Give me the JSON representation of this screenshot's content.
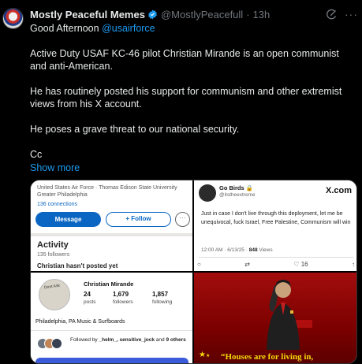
{
  "post": {
    "display_name": "Mostly Peaceful Memes",
    "handle": "@MostlyPeacefull",
    "time": "13h",
    "greeting": "Good Afternoon",
    "mention": "@usairforce",
    "paragraphs": [
      "Active Duty USAF KC-46 pilot Christian Mirande is an open communist and anti-American.",
      "He has routinely posted his support for communism and other extremist views from his X account.",
      "He poses a grave threat to our national security.",
      "Cc"
    ],
    "show_more": "Show more"
  },
  "panel_linkedin": {
    "subtitle": "United States Air Force · Thomas Edison State University",
    "location": "Greater Philadelphia",
    "connections": "136 connections",
    "message_label": "Message",
    "follow_label": "+ Follow",
    "more_label": "···",
    "activity_title": "Activity",
    "followers": "135 followers",
    "no_posts": "Christian hasn't posted yet"
  },
  "panel_xpost": {
    "name": "Go Birds",
    "handle": "@itstheextreme",
    "logo": "X.com",
    "text": "Just in case I don't live through this deployment, let me be unequivocal, fuck Israel, Free Palestine, Communism will win",
    "timestamp": "12:00 AM · 6/13/25 ·",
    "views_count": "848",
    "views_label": "Views",
    "like_count": "16"
  },
  "panel_profile": {
    "avatar_sign": "Dont Ask",
    "name": "Christian Mirande",
    "stats": [
      {
        "n": "24",
        "l": "posts"
      },
      {
        "n": "1,679",
        "l": "followers"
      },
      {
        "n": "1,857",
        "l": "following"
      }
    ],
    "location": "Philadelphia, PA Music & Surfboards",
    "followed_by_prefix": "Followed by",
    "followed_by_names": "_helm_, sensitive_jock",
    "followed_by_suffix": "and",
    "followed_by_others": "9 others"
  },
  "panel_photo": {
    "caption": "“Houses are for living in,"
  },
  "colors": {
    "background": "#000000",
    "text": "#e7e9ea",
    "muted": "#71767b",
    "accent": "#1d9bf0",
    "linkedin_blue": "#0a66c2",
    "caption_yellow": "#f5d90a"
  },
  "icons": [
    "verified-badge-icon",
    "grok-icon",
    "more-options-icon",
    "reply-icon",
    "retweet-icon",
    "like-icon",
    "share-icon"
  ]
}
